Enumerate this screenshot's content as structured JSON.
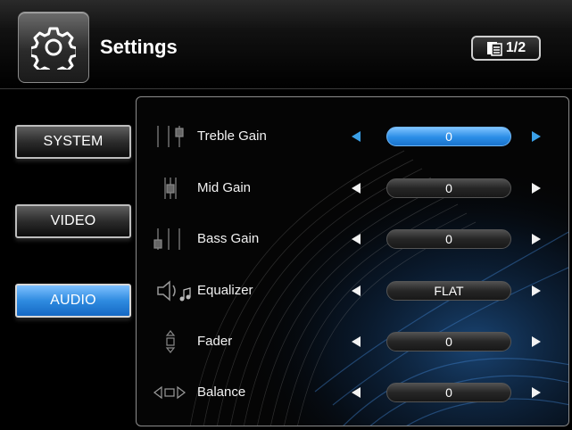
{
  "header": {
    "title": "Settings",
    "page_indicator": "1/2"
  },
  "sidebar": {
    "items": [
      {
        "label": "SYSTEM",
        "active": false
      },
      {
        "label": "VIDEO",
        "active": false
      },
      {
        "label": "AUDIO",
        "active": true
      }
    ]
  },
  "settings": {
    "rows": [
      {
        "label": "Treble Gain",
        "value": "0",
        "icon": "treble-icon",
        "selected": true
      },
      {
        "label": "Mid Gain",
        "value": "0",
        "icon": "mid-icon",
        "selected": false
      },
      {
        "label": "Bass Gain",
        "value": "0",
        "icon": "bass-icon",
        "selected": false
      },
      {
        "label": "Equalizer",
        "value": "FLAT",
        "icon": "speaker-music-icon",
        "selected": false
      },
      {
        "label": "Fader",
        "value": "0",
        "icon": "fader-icon",
        "selected": false
      },
      {
        "label": "Balance",
        "value": "0",
        "icon": "balance-icon",
        "selected": false
      }
    ]
  },
  "colors": {
    "accent": "#2a8de6",
    "arrow_active": "#3aa0e8",
    "background": "#000000"
  }
}
